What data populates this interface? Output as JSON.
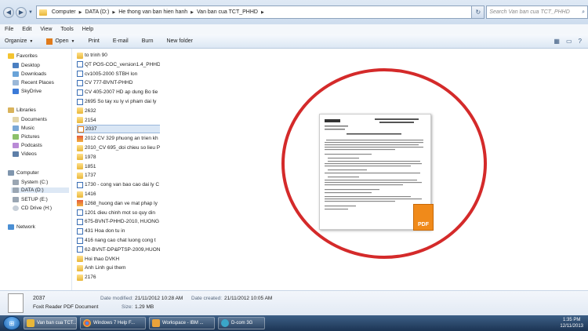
{
  "breadcrumb": [
    "Computer",
    "DATA (D:)",
    "He thong van ban hien hanh",
    "Van ban cua TCT_PHHD"
  ],
  "search": {
    "placeholder": "Search Van ban cua TCT_PHHD"
  },
  "menu": [
    "File",
    "Edit",
    "View",
    "Tools",
    "Help"
  ],
  "toolbar": {
    "organize": "Organize",
    "open": "Open",
    "print": "Print",
    "email": "E-mail",
    "burn": "Burn",
    "new_folder": "New folder"
  },
  "nav": {
    "favorites": "Favorites",
    "favorites_items": [
      "Desktop",
      "Downloads",
      "Recent Places",
      "SkyDrive"
    ],
    "libraries": "Libraries",
    "libraries_items": [
      "Documents",
      "Music",
      "Pictures",
      "Podcasts",
      "Videos"
    ],
    "computer": "Computer",
    "computer_items": [
      "System (C:)",
      "DATA (D:)",
      "SETUP (E:)",
      "CD Drive (H:)"
    ],
    "network": "Network"
  },
  "files": [
    {
      "name": "to trinh 90",
      "type": "folder"
    },
    {
      "name": "QT POS-COC_version1.4_PHHD",
      "type": "doc"
    },
    {
      "name": "cv1005-2000 STBH lon",
      "type": "doc"
    },
    {
      "name": "CV 777-BVNT-PHHD",
      "type": "doc"
    },
    {
      "name": "CV 405-2007 HD ap dung Bo tie",
      "type": "doc"
    },
    {
      "name": "2695 So tay xu ly vi pham dai ly",
      "type": "doc"
    },
    {
      "name": "2632",
      "type": "folder"
    },
    {
      "name": "2154",
      "type": "folder"
    },
    {
      "name": "2037",
      "type": "pdf",
      "selected": true
    },
    {
      "name": "2012 CV 329 phuong an trien kh",
      "type": "img"
    },
    {
      "name": "2010_CV 695_doi chieu so lieu P",
      "type": "folder"
    },
    {
      "name": "1978",
      "type": "folder"
    },
    {
      "name": "1851",
      "type": "folder"
    },
    {
      "name": "1737",
      "type": "folder"
    },
    {
      "name": "1730 - cong van bao cao dai ly C",
      "type": "doc"
    },
    {
      "name": "1416",
      "type": "folder"
    },
    {
      "name": "1268_huong dan ve mat phap ly",
      "type": "img"
    },
    {
      "name": "1201 dieu chinh mot so quy din",
      "type": "doc"
    },
    {
      "name": "675-BVNT-PHHD-2010, HUONG",
      "type": "doc"
    },
    {
      "name": "431 Hoa don tu in",
      "type": "doc"
    },
    {
      "name": "416 nang cao chat luong cong t",
      "type": "doc"
    },
    {
      "name": "62-BVNT-DP&PTSP-2009,HUON",
      "type": "doc"
    },
    {
      "name": "Hoi thao DVKH",
      "type": "folder"
    },
    {
      "name": "Anh Linh gui them",
      "type": "folder"
    },
    {
      "name": "2176",
      "type": "folder"
    }
  ],
  "details": {
    "name": "2037",
    "type": "Foxit Reader PDF Document",
    "modified_label": "Date modified:",
    "modified_value": "21/11/2012 10:28 AM",
    "size_label": "Size:",
    "size_value": "1.29 MB",
    "created_label": "Date created:",
    "created_value": "21/11/2012 10:05 AM"
  },
  "preview": {
    "badge": "PDF"
  },
  "taskbar": {
    "tasks": [
      "Van ban cua TCT...",
      "Windows 7 Help F...",
      "Workspace - IBM ...",
      "D-com 3G"
    ],
    "time": "1:35 PM",
    "date": "12/11/2013"
  }
}
